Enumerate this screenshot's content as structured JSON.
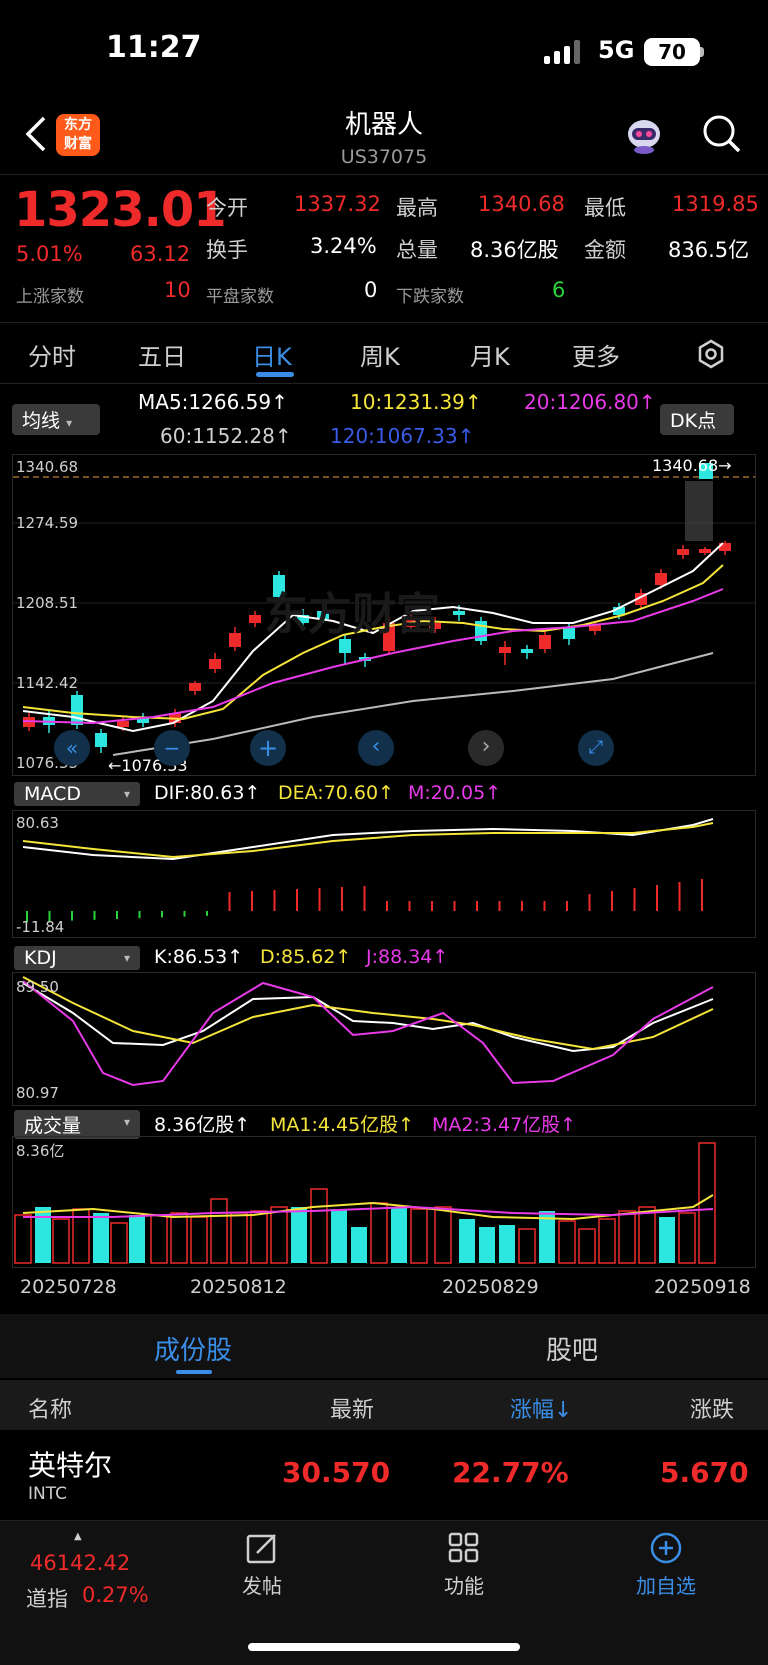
{
  "status": {
    "time": "11:27",
    "network": "5G",
    "battery": "70"
  },
  "header": {
    "title": "机器人",
    "code": "US37075",
    "logo_text": "东方财富"
  },
  "quote": {
    "price": "1323.01",
    "change_pct": "5.01%",
    "change": "63.12",
    "open_label": "今开",
    "open": "1337.32",
    "high_label": "最高",
    "high": "1340.68",
    "low_label": "最低",
    "low": "1319.85",
    "turnover_label": "换手",
    "turnover": "3.24%",
    "volume_label": "总量",
    "volume": "8.36亿股",
    "amount_label": "金额",
    "amount": "836.5亿",
    "up_label": "上涨家数",
    "up": "10",
    "flat_label": "平盘家数",
    "flat": "0",
    "down_label": "下跌家数",
    "down": "6"
  },
  "tabs": [
    "分时",
    "五日",
    "日K",
    "周K",
    "月K",
    "更多",
    ""
  ],
  "ma": {
    "selector": "均线",
    "ma5": "MA5:1266.59↑",
    "ma10": "10:1231.39↑",
    "ma20": "20:1206.80↑",
    "ma60": "60:1152.28↑",
    "ma120": "120:1067.33↑",
    "dk": "DK点"
  },
  "main_chart": {
    "y_labels": [
      "1340.68",
      "1274.59",
      "1208.51",
      "1142.42",
      "1076.33"
    ],
    "high_marker": "1340.68→",
    "low_marker": "←1076.33",
    "watermark": "东方财富"
  },
  "macd": {
    "selector": "MACD",
    "dif": "DIF:80.63↑",
    "dea": "DEA:70.60↑",
    "m": "M:20.05↑",
    "top": "80.63",
    "bottom": "-11.84"
  },
  "kdj": {
    "selector": "KDJ",
    "k": "K:86.53↑",
    "d": "D:85.62↑",
    "j": "J:88.34↑",
    "top": "89.50",
    "bottom": "80.97"
  },
  "vol": {
    "selector": "成交量",
    "v": "8.36亿股↑",
    "ma1": "MA1:4.45亿股↑",
    "ma2": "MA2:3.47亿股↑",
    "top": "8.36亿"
  },
  "dates": [
    "20250728",
    "20250812",
    "20250829",
    "20250918"
  ],
  "section": {
    "tab1": "成份股",
    "tab2": "股吧"
  },
  "table": {
    "headers": [
      "名称",
      "最新",
      "涨幅↓",
      "涨跌"
    ],
    "rows": [
      {
        "name": "英特尔",
        "code": "INTC",
        "last": "30.570",
        "pct": "22.77%",
        "chg": "5.670"
      }
    ]
  },
  "bottom": {
    "index_value": "46142.42",
    "index_name": "道指",
    "index_pct": "0.27%",
    "post": "发帖",
    "func": "功能",
    "add": "加自选"
  },
  "colors": {
    "up": "#ee2a2a",
    "down": "#2ee6e0",
    "accent": "#3a8ee6"
  }
}
